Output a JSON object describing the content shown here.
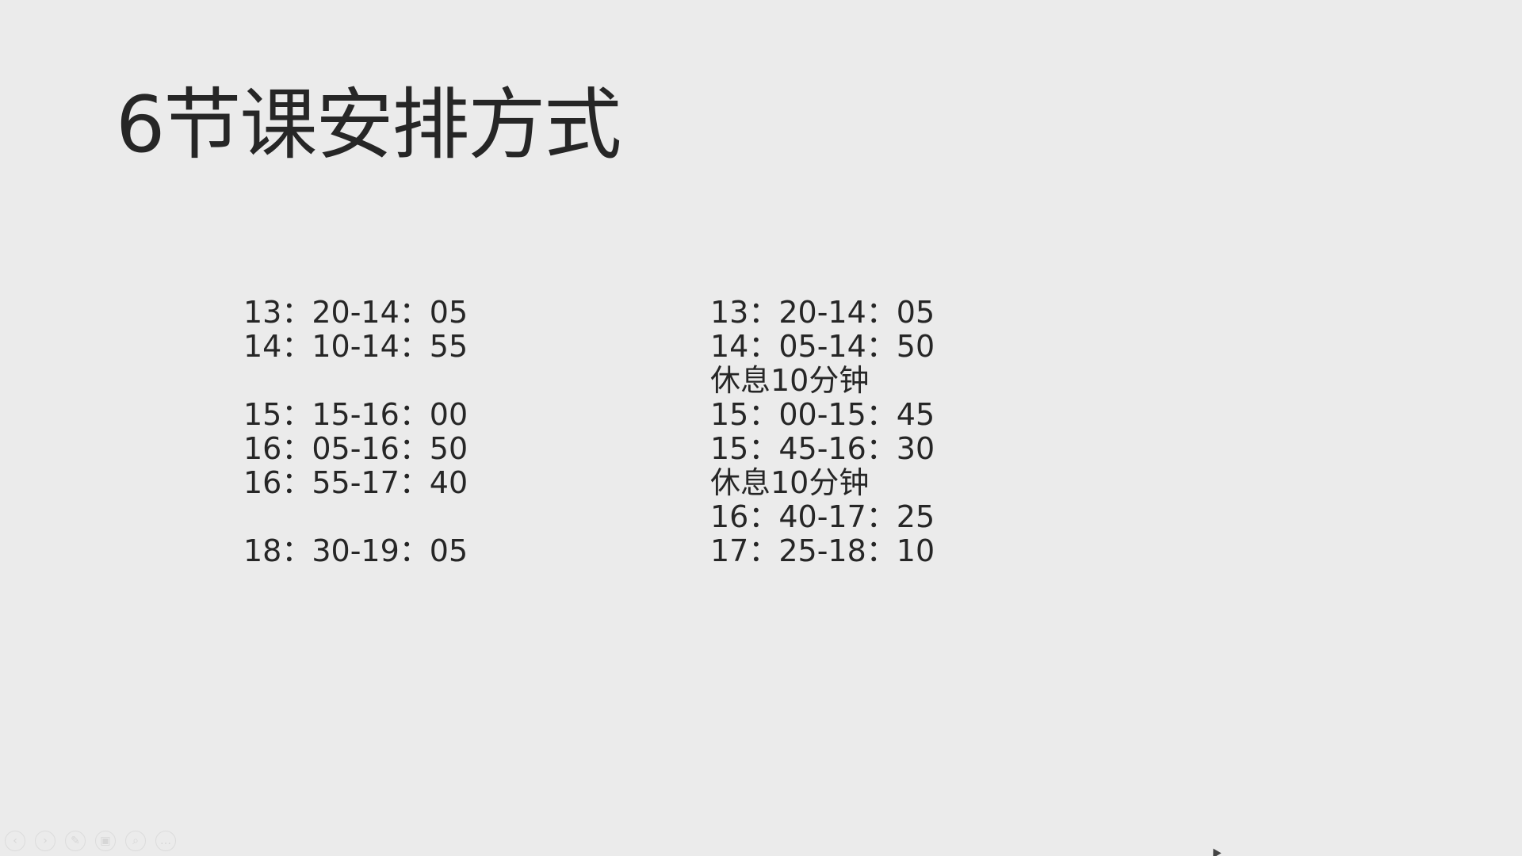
{
  "slide": {
    "title": "6节课安排方式"
  },
  "schedule_left": {
    "lines": [
      "13：20-14：05",
      "14：10-14：55",
      "",
      "15：15-16：00",
      "16：05-16：50",
      "16：55-17：40",
      "",
      "18：30-19：05"
    ]
  },
  "schedule_right": {
    "lines": [
      "13：20-14：05",
      "14：05-14：50",
      "休息10分钟",
      "15：00-15：45",
      "15：45-16：30",
      "休息10分钟",
      "16：40-17：25",
      "17：25-18：10"
    ]
  },
  "toolbar": {
    "buttons": [
      {
        "name": "prev-slide-button",
        "icon": "arrow-left-icon",
        "glyph": "‹"
      },
      {
        "name": "next-slide-button",
        "icon": "arrow-right-icon",
        "glyph": "›"
      },
      {
        "name": "pen-button",
        "icon": "pen-icon",
        "glyph": "✎"
      },
      {
        "name": "slides-overview-button",
        "icon": "slides-icon",
        "glyph": "▣"
      },
      {
        "name": "zoom-button",
        "icon": "magnifier-icon",
        "glyph": "⌕"
      },
      {
        "name": "more-options-button",
        "icon": "more-icon",
        "glyph": "…"
      }
    ]
  }
}
